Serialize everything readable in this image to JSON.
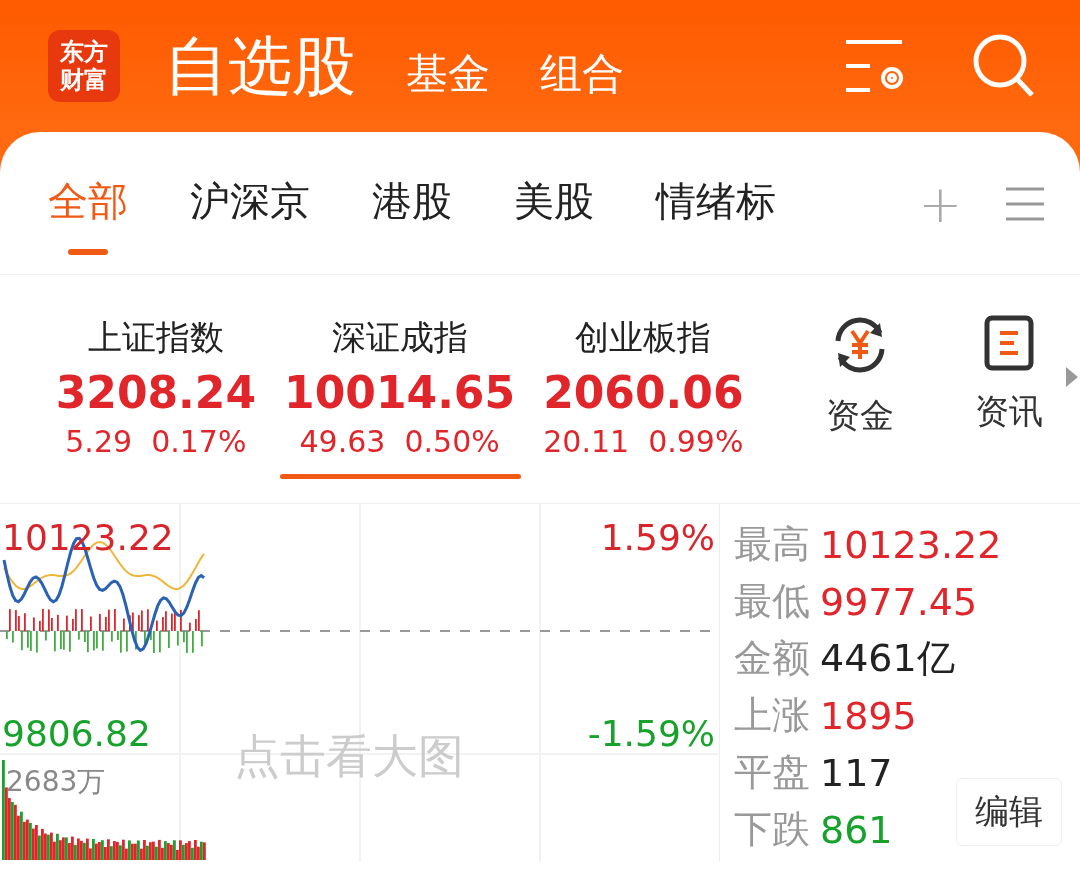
{
  "header": {
    "logo": [
      "东方",
      "财富"
    ],
    "tabs": [
      {
        "label": "自选股",
        "selected": true
      },
      {
        "label": "基金",
        "selected": false
      },
      {
        "label": "组合",
        "selected": false
      }
    ]
  },
  "sub_tabs": {
    "items": [
      {
        "label": "全部",
        "selected": true
      },
      {
        "label": "沪深京",
        "selected": false
      },
      {
        "label": "港股",
        "selected": false
      },
      {
        "label": "美股",
        "selected": false
      },
      {
        "label": "情绪标",
        "selected": false
      }
    ],
    "add": "+"
  },
  "indices": [
    {
      "name": "上证指数",
      "value": "3208.24",
      "change": "5.29",
      "percent": "0.17%",
      "color": "#e0252b",
      "selected": false
    },
    {
      "name": "深证成指",
      "value": "10014.65",
      "change": "49.63",
      "percent": "0.50%",
      "color": "#e0252b",
      "selected": true
    },
    {
      "name": "创业板指",
      "value": "2060.06",
      "change": "20.11",
      "percent": "0.99%",
      "color": "#e0252b",
      "selected": false
    }
  ],
  "shortcuts": [
    {
      "label": "资金",
      "kind": "money"
    },
    {
      "label": "资讯",
      "kind": "news"
    }
  ],
  "chart": {
    "high": "10123.22",
    "high_percent": "1.59%",
    "low": "9806.82",
    "low_percent": "-1.59%",
    "volume": "2683万",
    "hint": "点击看大图"
  },
  "stats": [
    {
      "label": "最高",
      "value": "10123.22",
      "color": "#e0252b"
    },
    {
      "label": "最低",
      "value": "9977.45",
      "color": "#e0252b"
    },
    {
      "label": "金额",
      "value": "4461亿",
      "color": "#222222"
    },
    {
      "label": "上涨",
      "value": "1895",
      "color": "#e0252b"
    },
    {
      "label": "平盘",
      "value": "117",
      "color": "#222222"
    },
    {
      "label": "下跌",
      "value": "861",
      "color": "#17a22c"
    }
  ],
  "edit_button": "编辑"
}
